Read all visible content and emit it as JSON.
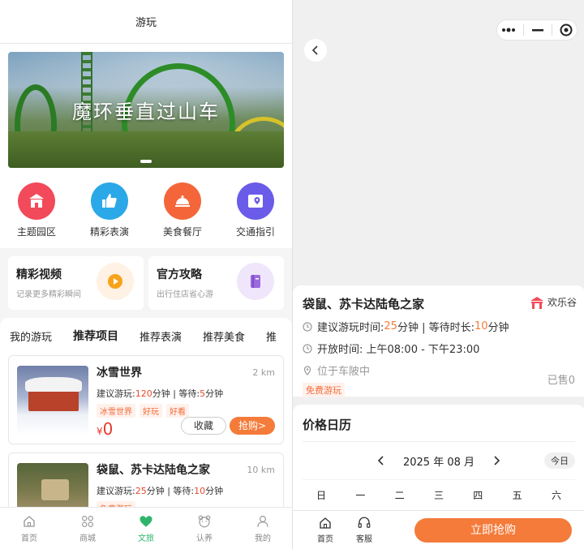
{
  "left": {
    "nav_title": "游玩",
    "banner_title": "魔环垂直过山车",
    "quick": [
      {
        "label": "主题园区",
        "icon": "gate-icon",
        "color": "#f24a5a"
      },
      {
        "label": "精彩表演",
        "icon": "thumbs-up-icon",
        "color": "#2aa8e8"
      },
      {
        "label": "美食餐厅",
        "icon": "food-cover-icon",
        "color": "#f4663a"
      },
      {
        "label": "交通指引",
        "icon": "map-pin-icon",
        "color": "#6a5ce8"
      }
    ],
    "cards": [
      {
        "title": "精彩视频",
        "sub": "记录更多精彩瞬间",
        "icon": "play-icon"
      },
      {
        "title": "官方攻略",
        "sub": "出行住店省心游",
        "icon": "book-icon"
      }
    ],
    "tabs": [
      "我的游玩",
      "推荐项目",
      "推荐表演",
      "推荐美食",
      "推"
    ],
    "items": [
      {
        "name": "冰雪世界",
        "distance": "2 km",
        "desc_prefix": "建议游玩:",
        "play_min": "120",
        "desc_mid": "分钟 | 等待:",
        "wait_min": "5",
        "desc_suffix": "分钟",
        "tags": [
          "冰雪世界",
          "好玩",
          "好看"
        ],
        "currency": "¥",
        "price": "0",
        "fav_label": "收藏",
        "buy_label": "抢购>"
      },
      {
        "name": "袋鼠、苏卡达陆龟之家",
        "distance": "10 km",
        "desc_prefix": "建议游玩:",
        "play_min": "25",
        "desc_mid": "分钟 | 等待:",
        "wait_min": "10",
        "desc_suffix": "分钟",
        "tags": [
          "免费游玩"
        ]
      }
    ],
    "bottom_nav": [
      {
        "label": "首页",
        "icon": "home-icon"
      },
      {
        "label": "商城",
        "icon": "grid-icon"
      },
      {
        "label": "文旅",
        "icon": "heart-icon",
        "active": true
      },
      {
        "label": "认养",
        "icon": "bear-icon"
      },
      {
        "label": "我的",
        "icon": "user-icon"
      }
    ]
  },
  "right": {
    "detail": {
      "name": "袋鼠、苏卡达陆龟之家",
      "brand": "欢乐谷",
      "row1_prefix": "建议游玩时间:",
      "row1_play": "25",
      "row1_mid": "分钟 | 等待时长:",
      "row1_wait": "10",
      "row1_suffix": "分钟",
      "open_time": "开放时间: 上午08:00 - 下午23:00",
      "location": "位于车陂中",
      "free_tag": "免费游玩",
      "sold": "已售0"
    },
    "calendar": {
      "title": "价格日历",
      "month": "2025 年 08 月",
      "today": "今日",
      "weekdays": [
        "日",
        "一",
        "二",
        "三",
        "四",
        "五",
        "六"
      ]
    },
    "bottom": {
      "home": "首页",
      "service": "客服",
      "buy_now": "立即抢购"
    }
  }
}
